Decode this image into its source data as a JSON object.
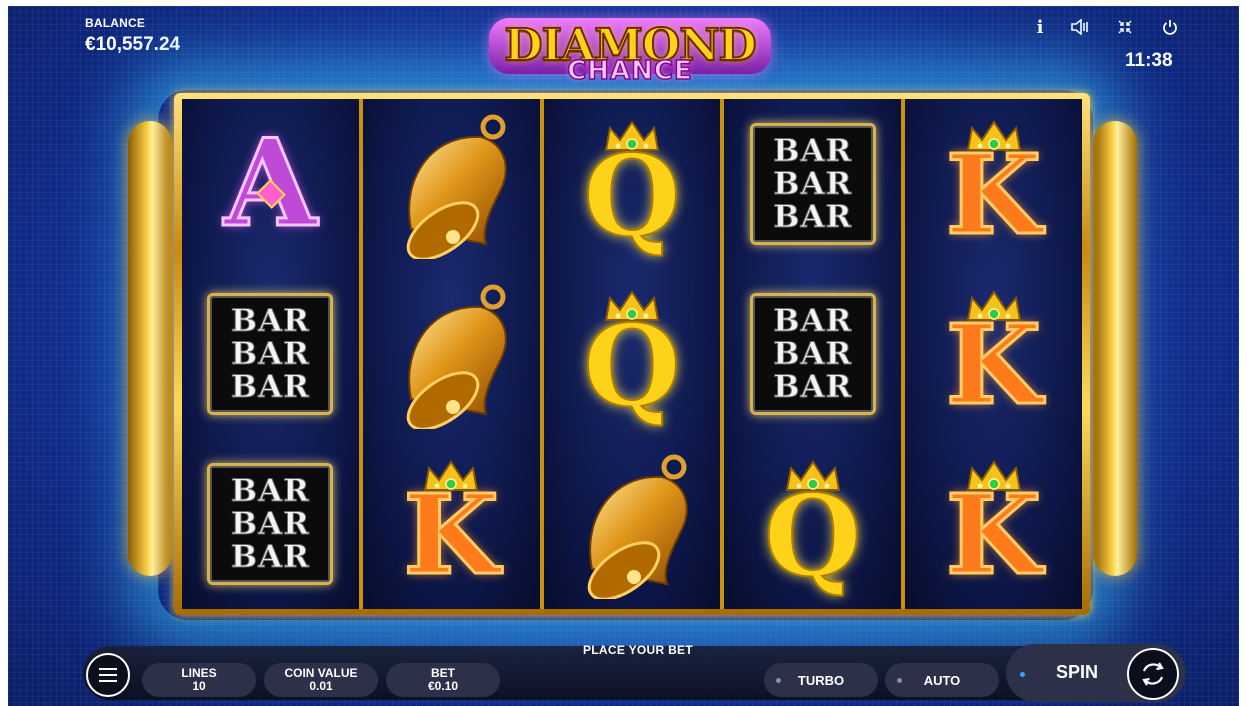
{
  "header": {
    "balance_label": "BALANCE",
    "balance_value": "€10,557.24",
    "clock": "11:38",
    "icons": [
      "info-icon",
      "sound-icon",
      "fullscreen-icon",
      "power-icon"
    ]
  },
  "logo": {
    "main": "DIAMOND",
    "sub": "CHANCE"
  },
  "reels": [
    [
      "ace",
      "bar",
      "bar"
    ],
    [
      "bell",
      "bell",
      "king"
    ],
    [
      "queen",
      "queen",
      "bell"
    ],
    [
      "bar",
      "bar",
      "queen"
    ],
    [
      "king",
      "king",
      "king"
    ]
  ],
  "symbols": {
    "bar_text": "BAR",
    "ace": "A",
    "queen": "Q",
    "king": "K"
  },
  "controls": {
    "status": "PLACE YOUR BET",
    "lines_label": "LINES",
    "lines_value": "10",
    "coin_label": "COIN VALUE",
    "coin_value": "0.01",
    "bet_label": "BET",
    "bet_value": "€0.10",
    "turbo_label": "TURBO",
    "auto_label": "AUTO",
    "spin_label": "SPIN"
  },
  "colors": {
    "background": "#1a3fb0",
    "frame_gold": "#ffd85a",
    "reel_bg": "#0c1544",
    "glow": "#3cc8ff"
  }
}
